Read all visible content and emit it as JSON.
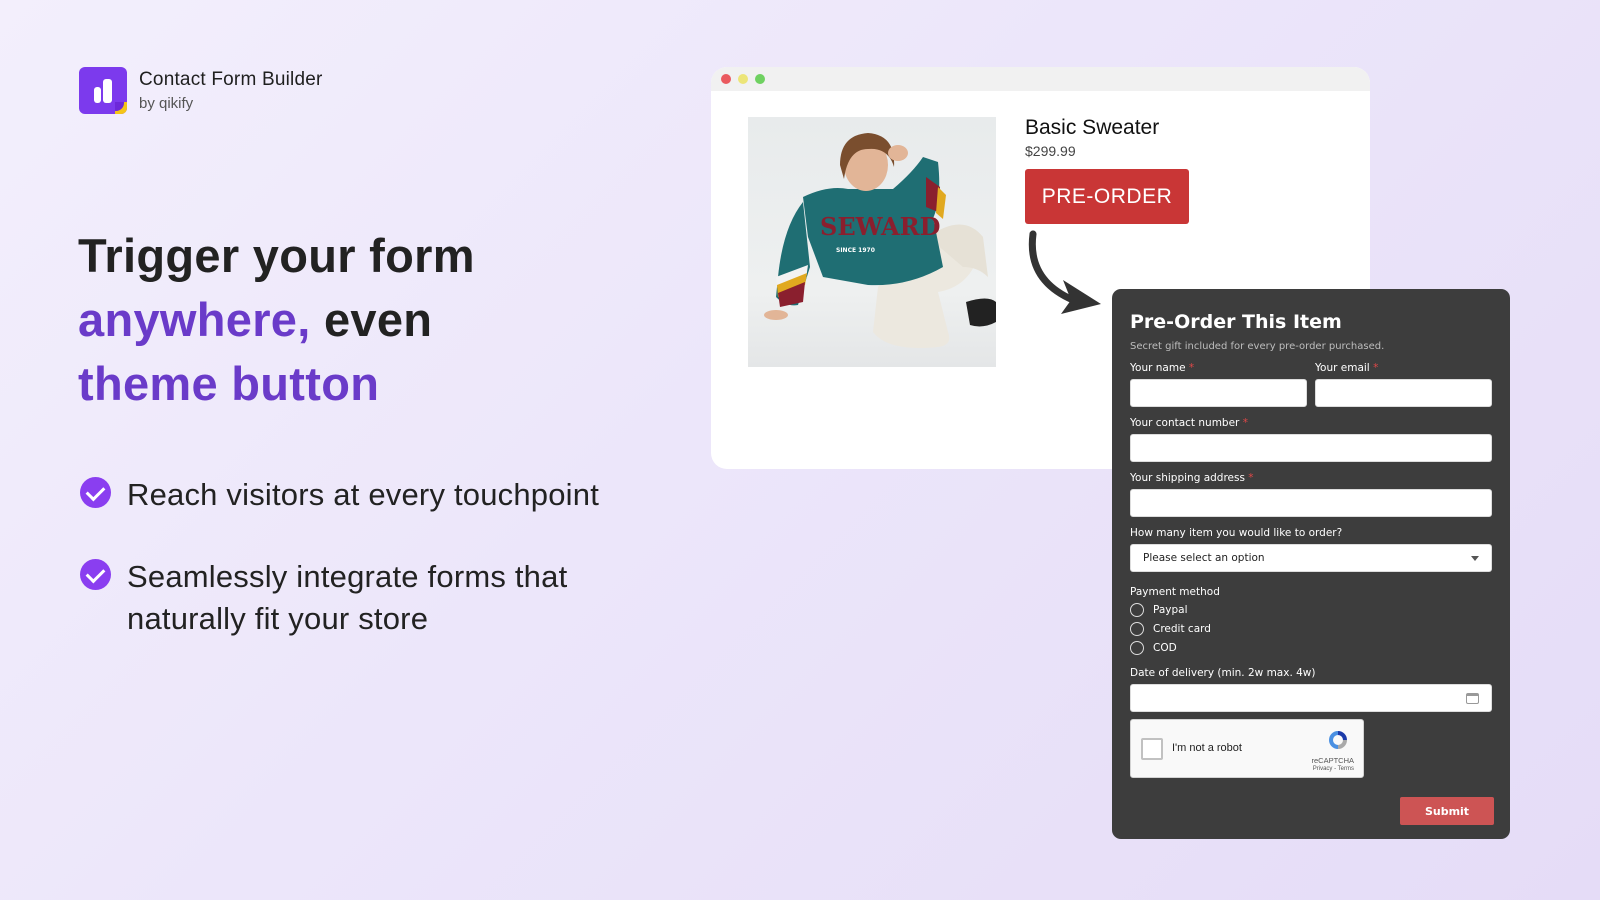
{
  "brand": {
    "title": "Contact Form Builder",
    "subtitle": "by qikify",
    "color": "#7c3aed"
  },
  "headline": {
    "line1": "Trigger your form",
    "line2_accent": "anywhere,",
    "line2_rest": " even",
    "line3_accent": "theme button",
    "accent_color": "#6a3bc9"
  },
  "bullets": [
    {
      "icon": "check-circle-icon",
      "text": "Reach visitors at every touchpoint"
    },
    {
      "icon": "check-circle-icon",
      "text": "Seamlessly integrate forms that naturally fit your store"
    }
  ],
  "product": {
    "title": "Basic Sweater",
    "price": "$299.99",
    "button_label": "PRE-ORDER",
    "image_alt": "Woman in teal SEWARD sweater",
    "sweater_print": "SEWARD",
    "sweater_sub": "SINCE 1970",
    "button_color": "#c93636"
  },
  "form": {
    "title": "Pre-Order This Item",
    "subtitle": "Secret gift included for every pre-order purchased.",
    "required_marker": "*",
    "fields": {
      "name_label": "Your name",
      "email_label": "Your email",
      "contact_label": "Your contact number",
      "address_label": "Your shipping address",
      "quantity_label": "How many item you would like to order?",
      "quantity_selected": "Please select an option",
      "payment_label": "Payment method",
      "payment_options": [
        "Paypal",
        "Credit card",
        "COD"
      ],
      "date_label": "Date of delivery (min. 2w max. 4w)"
    },
    "captcha": {
      "label": "I'm not a robot",
      "brand": "reCAPTCHA",
      "links": "Privacy - Terms"
    },
    "submit_label": "Submit"
  }
}
